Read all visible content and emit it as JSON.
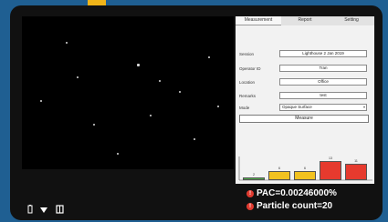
{
  "tabs": [
    "Measurement",
    "Report",
    "Setting"
  ],
  "form": {
    "session_label": "Session",
    "session_value": "Lighthouse 2 Jan 2019",
    "operator_label": "Operator ID",
    "operator_value": "Tran",
    "location_label": "Location",
    "location_value": "Office",
    "remarks_label": "Remarks",
    "remarks_value": "test",
    "mode_label": "Mode",
    "mode_value": "Opaque Surface"
  },
  "measure_label": "Measure",
  "chart_data": {
    "type": "bar",
    "categories": [
      "",
      "",
      "",
      "",
      ""
    ],
    "values": [
      2,
      6,
      6,
      13,
      11
    ],
    "colors": [
      "#4caa48",
      "#f2c21f",
      "#f2c21f",
      "#e63a2e",
      "#e63a2e"
    ],
    "ylim": [
      0,
      15
    ]
  },
  "status": {
    "pac": "PAC=0.00246000%",
    "particle_count": "Particle count=20"
  },
  "icons": [
    "battery-icon",
    "wifi-icon",
    "storage-icon",
    "warning-icon"
  ],
  "accent_color": "#f0b419"
}
